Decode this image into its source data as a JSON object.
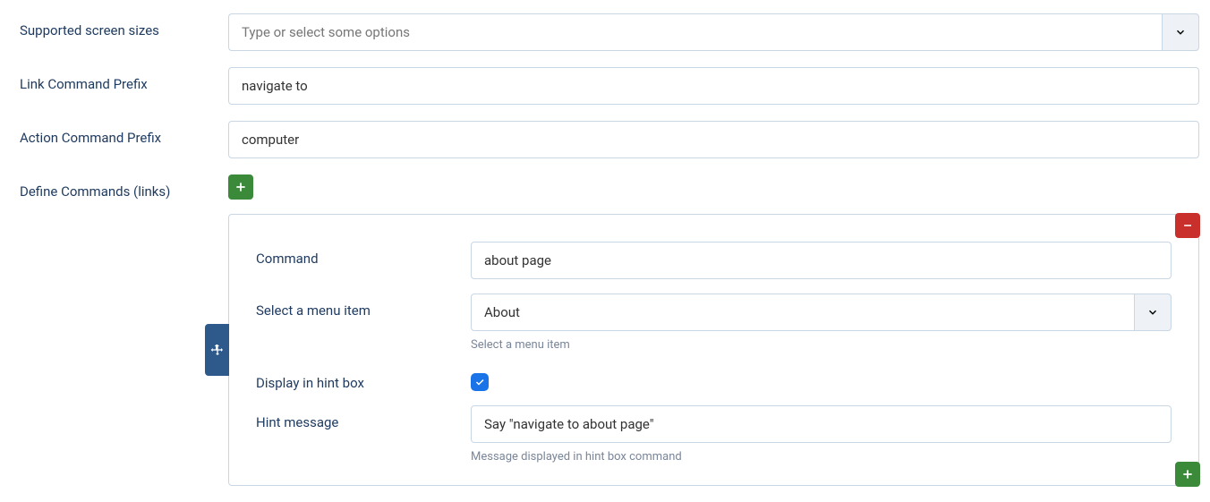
{
  "fields": {
    "screen_sizes": {
      "label": "Supported screen sizes",
      "placeholder": "Type or select some options"
    },
    "link_prefix": {
      "label": "Link Command Prefix",
      "value": "navigate to"
    },
    "action_prefix": {
      "label": "Action Command Prefix",
      "value": "computer"
    },
    "define_commands": {
      "label": "Define Commands (links)"
    }
  },
  "command_block": {
    "command": {
      "label": "Command",
      "value": "about page"
    },
    "menu_item": {
      "label": "Select a menu item",
      "value": "About",
      "help": "Select a menu item"
    },
    "display_hint": {
      "label": "Display in hint box",
      "checked": true
    },
    "hint_message": {
      "label": "Hint message",
      "value": "Say \"navigate to about page\"",
      "help": "Message displayed in hint box command"
    }
  }
}
